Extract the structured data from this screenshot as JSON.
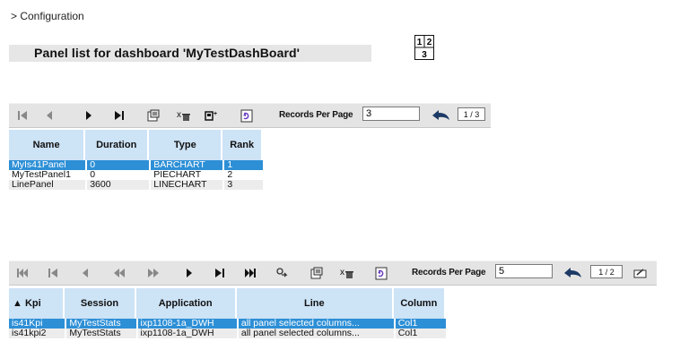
{
  "breadcrumb": "> Configuration",
  "page_title": "Panel list for dashboard 'MyTestDashBoard'",
  "layout_icon": {
    "cells": [
      "1",
      "2",
      "3"
    ]
  },
  "panels": {
    "records_per_page_label": "Records Per Page",
    "records_per_page_value": "3",
    "pager": "1 / 3",
    "columns": [
      "Name",
      "Duration",
      "Type",
      "Rank"
    ],
    "rows": [
      {
        "name": "MyIs41Panel",
        "duration": "0",
        "type": "BARCHART",
        "rank": "1",
        "selected": true
      },
      {
        "name": "MyTestPanel1",
        "duration": "0",
        "type": "PIECHART",
        "rank": "2",
        "selected": false
      },
      {
        "name": "LinePanel",
        "duration": "3600",
        "type": "LINECHART",
        "rank": "3",
        "selected": false
      }
    ]
  },
  "kpis": {
    "records_per_page_label": "Records Per Page",
    "records_per_page_value": "5",
    "pager": "1 / 2",
    "columns": [
      "Kpi",
      "Session",
      "Application",
      "Line",
      "Column"
    ],
    "sort_indicator": "▲",
    "rows": [
      {
        "kpi": "is41Kpi",
        "session": "MyTestStats",
        "application": "ixp1108-1a_DWH",
        "line": "all panel selected columns...",
        "column": "Col1",
        "selected": true
      },
      {
        "kpi": "is41kpi2",
        "session": "MyTestStats",
        "application": "ixp1108-1a_DWH",
        "line": "all panel selected columns...",
        "column": "Col1",
        "selected": false
      }
    ]
  },
  "colors": {
    "toolbar": "#e4e4e4",
    "header": "#cde3f6",
    "selected": "#2d8fd6"
  }
}
